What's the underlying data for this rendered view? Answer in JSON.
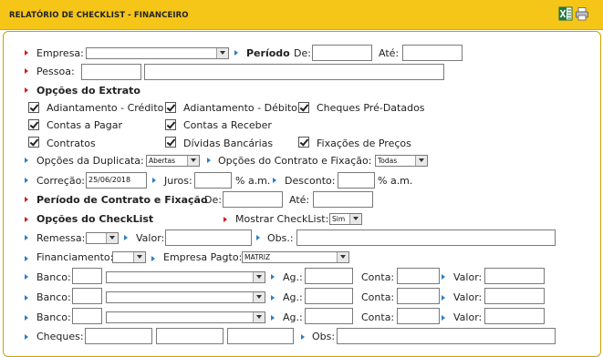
{
  "header": {
    "title": "RELATÓRIO DE CHECKLIST - FINANCEIRO",
    "excel_icon": "excel-icon",
    "print_icon": "printer-icon"
  },
  "form": {
    "empresa_label": "Empresa:",
    "periodo_label": "Período",
    "de_label": "De:",
    "ate_label": "Até:",
    "pessoa_label": "Pessoa:",
    "opcoes_extrato_label": "Opções do Extrato",
    "checkboxes": [
      "Adiantamento - Crédito",
      "Adiantamento - Débito",
      "Cheques Pré-Datados",
      "Contas a Pagar",
      "Contas a Receber",
      "Contratos",
      "Dívidas Bancárias",
      "Fixações de Preços"
    ],
    "opcoes_duplicata_label": "Opções da Duplicata:",
    "opcoes_duplicata_value": "Abertas",
    "opcoes_contrato_label": "Opções do Contrato e Fixação:",
    "opcoes_contrato_value": "Todas",
    "correcao_label": "Correção:",
    "correcao_value": "25/06/2018",
    "juros_label": "Juros:",
    "am_label": "% a.m.",
    "desconto_label": "Desconto:",
    "periodo_contrato_label": "Período de Contrato e Fixação",
    "opcoes_checklist_label": "Opções do CheckList",
    "mostrar_checklist_label": "Mostrar CheckList:",
    "mostrar_checklist_value": "Sim",
    "remessa_label": "Remessa:",
    "valor_label": "Valor:",
    "obs_label": "Obs.:",
    "obs_colon_label": "Obs:",
    "financiamento_label": "Financiamento:",
    "empresa_pagto_label": "Empresa Pagto:",
    "empresa_pagto_value": "MATRIZ",
    "banco_label": "Banco:",
    "ag_label": "Ag.:",
    "conta_label": "Conta:",
    "cheques_label": "Cheques:"
  }
}
